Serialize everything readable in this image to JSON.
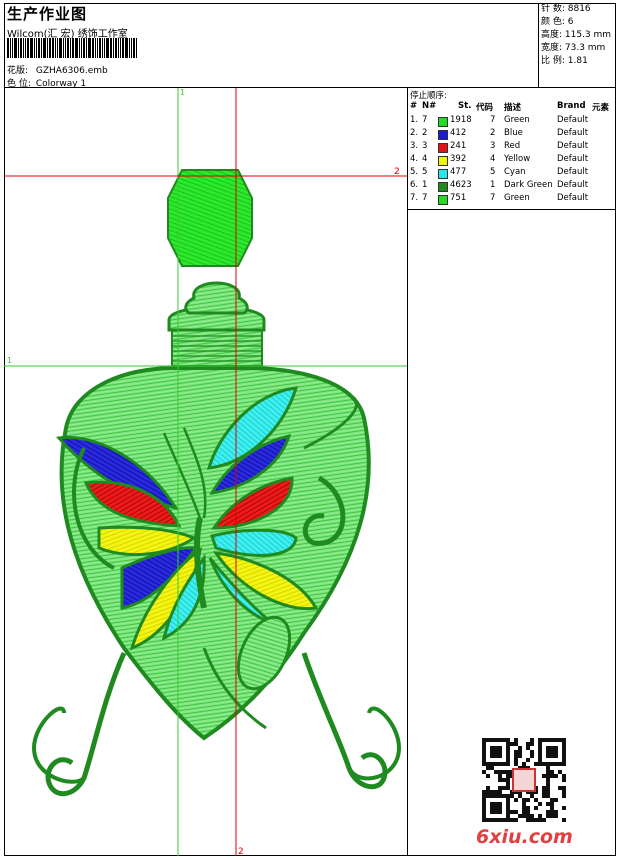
{
  "header": {
    "title": "生产作业图",
    "studio": "Wilcom(汇 宏) 绣饰工作室",
    "design_label": "花版:",
    "design_value": "GZHA6306.emb",
    "colorway_label": "色 位:",
    "colorway_value": "Colorway 1"
  },
  "stats": {
    "stitches": "针 数: 8816",
    "colors": "颜 色: 6",
    "height": "高度: 115.3 mm",
    "width": "宽度: 73.3 mm",
    "scale": "比 例: 1.81"
  },
  "stop_sequence": {
    "title": "停止顺序:",
    "headers": {
      "num": "#",
      "needle": "N#",
      "stitches": "St.",
      "code": "代码",
      "desc": "描述",
      "brand": "Brand",
      "element": "元素"
    },
    "rows": [
      {
        "num": "1.",
        "needle": "7",
        "color": "#22dd22",
        "stitches": "1918",
        "code": "7",
        "desc": "Green",
        "brand": "Default"
      },
      {
        "num": "2.",
        "needle": "2",
        "color": "#1a1ad8",
        "stitches": "412",
        "code": "2",
        "desc": "Blue",
        "brand": "Default"
      },
      {
        "num": "3.",
        "needle": "3",
        "color": "#e01515",
        "stitches": "241",
        "code": "3",
        "desc": "Red",
        "brand": "Default"
      },
      {
        "num": "4.",
        "needle": "4",
        "color": "#f2f20a",
        "stitches": "392",
        "code": "4",
        "desc": "Yellow",
        "brand": "Default"
      },
      {
        "num": "5.",
        "needle": "5",
        "color": "#22e8e8",
        "stitches": "477",
        "code": "5",
        "desc": "Cyan",
        "brand": "Default"
      },
      {
        "num": "6.",
        "needle": "1",
        "color": "#1f8a1f",
        "stitches": "4623",
        "code": "1",
        "desc": "Dark Green",
        "brand": "Default"
      },
      {
        "num": "7.",
        "needle": "7",
        "color": "#22dd22",
        "stitches": "751",
        "code": "7",
        "desc": "Green",
        "brand": "Default"
      }
    ]
  },
  "guides": {
    "v1": "1",
    "h1": "1",
    "v2": "2",
    "h2": "2"
  },
  "colors": {
    "guide_green": "#33cc33",
    "guide_red": "#dd0000"
  },
  "watermark": "6xiu.com"
}
